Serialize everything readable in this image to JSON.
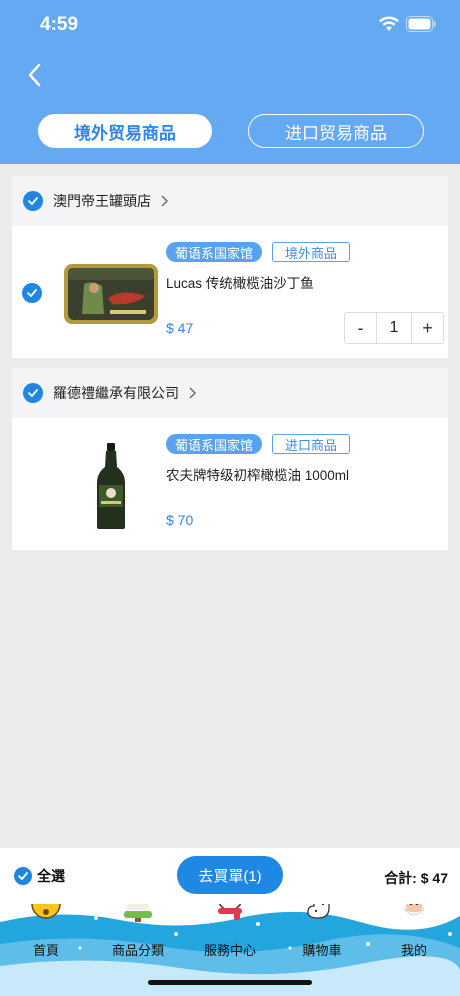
{
  "status": {
    "time": "4:59"
  },
  "tabs": [
    {
      "label": "境外贸易商品",
      "active": true
    },
    {
      "label": "进口贸易商品",
      "active": false
    }
  ],
  "stores": [
    {
      "name": "澳門帝王罐頭店",
      "items": [
        {
          "tag_primary": "葡语系国家馆",
          "tag_secondary": "境外商品",
          "title": "Lucas 传统橄榄油沙丁鱼",
          "price": "$ 47",
          "quantity": "1",
          "image": "sardine-tin"
        }
      ]
    },
    {
      "name": "羅德禮繼承有限公司",
      "items": [
        {
          "tag_primary": "葡语系国家馆",
          "tag_secondary": "进口商品",
          "title": "农夫牌特级初榨橄榄油 1000ml",
          "price": "$ 70",
          "image": "olive-oil-bottle"
        }
      ]
    }
  ],
  "stepper": {
    "minus": "-",
    "plus": "+"
  },
  "checkout": {
    "select_all": "全選",
    "button": "去買單(1)",
    "total": "合計: $ 47"
  },
  "tabbar": [
    {
      "label": "首頁",
      "icon": "bell-icon"
    },
    {
      "label": "商品分類",
      "icon": "christmas-tree-icon"
    },
    {
      "label": "服務中心",
      "icon": "snowman-icon"
    },
    {
      "label": "購物車",
      "icon": "stocking-icon"
    },
    {
      "label": "我的",
      "icon": "santa-icon"
    }
  ],
  "colors": {
    "header": "#64a9f2",
    "accent": "#1f86e2",
    "price": "#2e87e0"
  }
}
